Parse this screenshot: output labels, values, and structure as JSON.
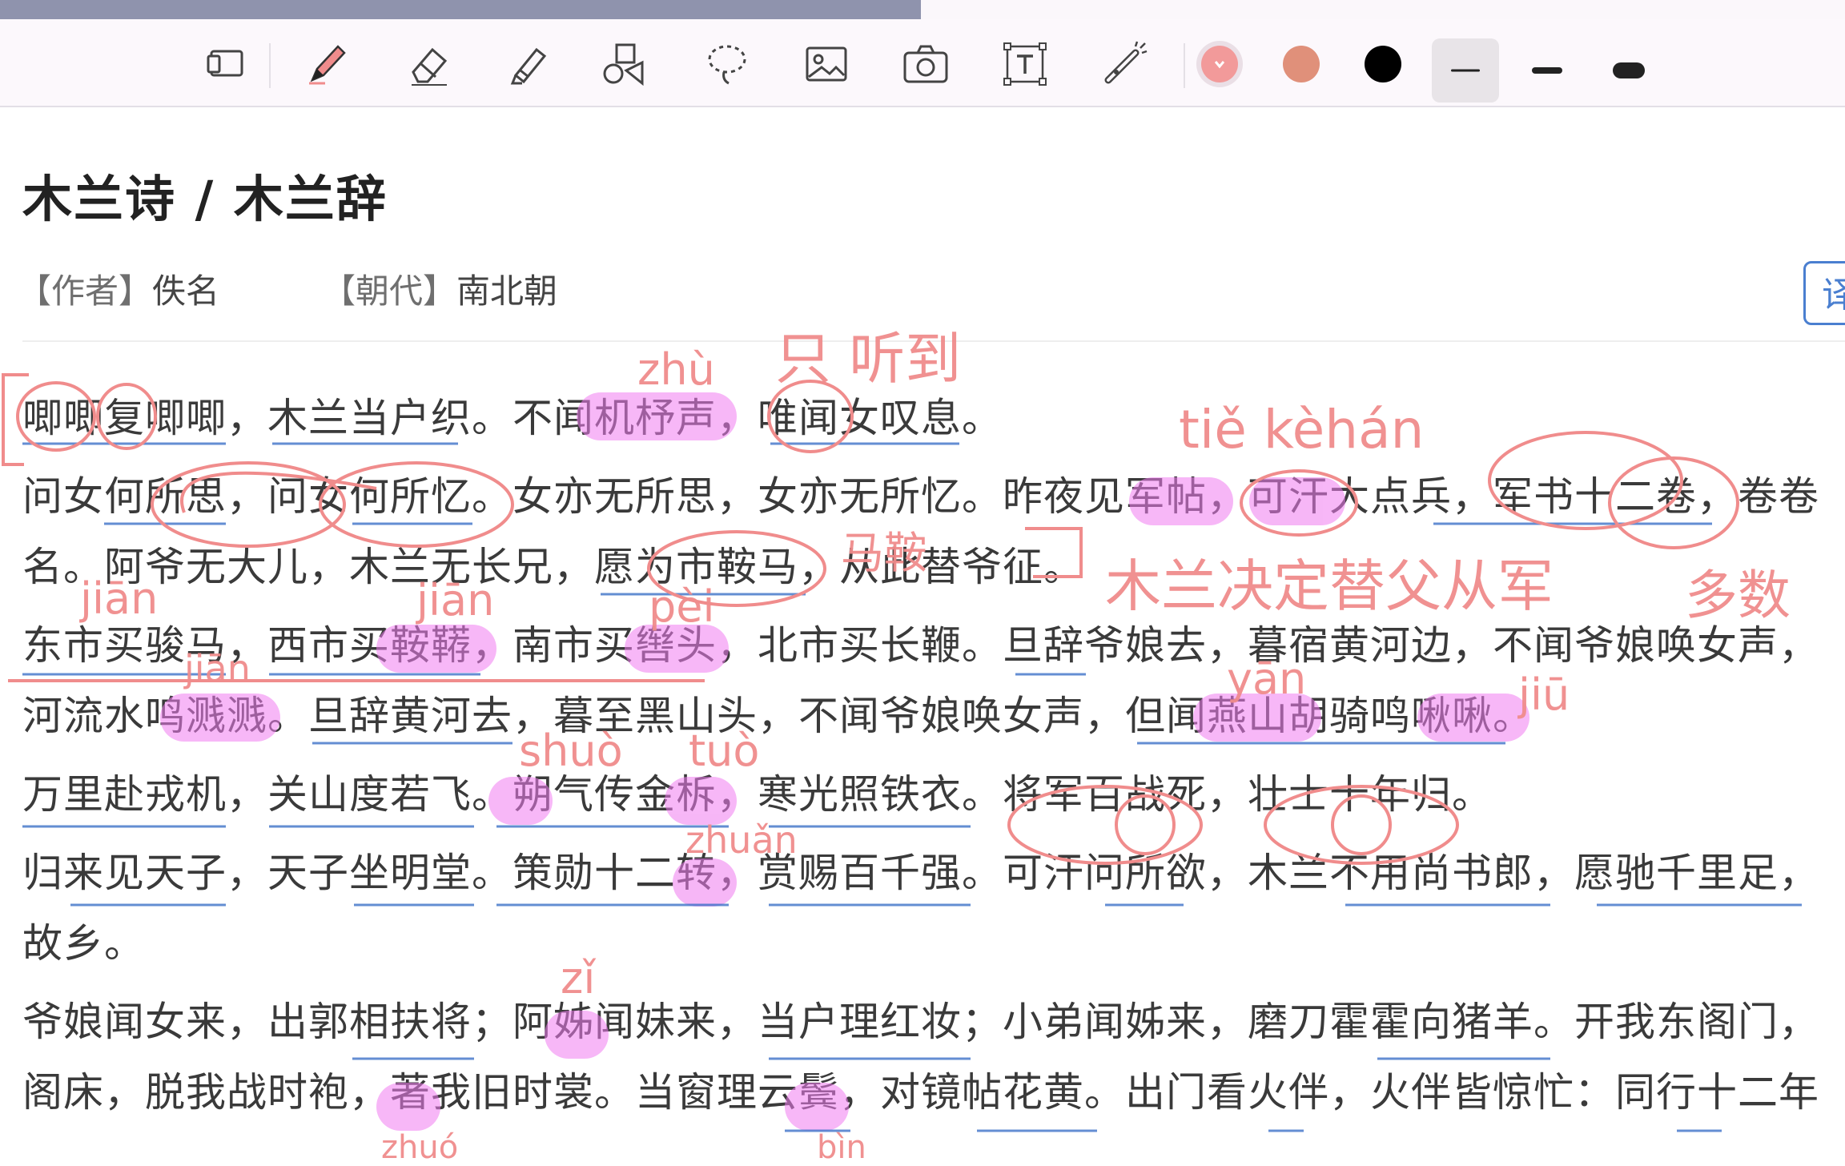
{
  "toolbar": {
    "tools": [
      {
        "name": "page-icon",
        "label": "Pages"
      },
      {
        "name": "pen-icon",
        "label": "Pen"
      },
      {
        "name": "eraser-icon",
        "label": "Eraser"
      },
      {
        "name": "highlighter-icon",
        "label": "Highlighter"
      },
      {
        "name": "shapes-icon",
        "label": "Shapes"
      },
      {
        "name": "lasso-icon",
        "label": "Lasso"
      },
      {
        "name": "image-icon",
        "label": "Image"
      },
      {
        "name": "camera-icon",
        "label": "Camera"
      },
      {
        "name": "text-box-icon",
        "label": "Text"
      },
      {
        "name": "laser-pointer-icon",
        "label": "Laser"
      }
    ],
    "colors": [
      "#f29a9a",
      "#e0907a",
      "#000000"
    ],
    "selected_color": "#f29a9a"
  },
  "article": {
    "title": "木兰诗 / 木兰辞",
    "author_label": "【作者】",
    "author": "佚名",
    "dynasty_label": "【朝代】",
    "dynasty": "南北朝",
    "translate_button": "译"
  },
  "poem": {
    "lines": [
      "唧唧复唧唧，木兰当户织。不闻机杼声，唯闻女叹息。",
      "问女何所思，问女何所忆。女亦无所思，女亦无所忆。昨夜见军帖，可汗大点兵，军书十二卷，卷卷",
      "名。阿爷无大儿，木兰无长兄，愿为市鞍马，从此替爷征。",
      "东市买骏马，西市买鞍鞯，南市买辔头，北市买长鞭。旦辞爷娘去，暮宿黄河边，不闻爷娘唤女声，",
      "河流水鸣溅溅。旦辞黄河去，暮至黑山头，不闻爷娘唤女声，但闻燕山胡骑鸣啾啾。",
      "万里赴戎机，关山度若飞。朔气传金柝，寒光照铁衣。将军百战死，壮士十年归。",
      "归来见天子，天子坐明堂。策勋十二转，赏赐百千强。可汗问所欲，木兰不用尚书郎，愿驰千里足，",
      "故乡。",
      "爷娘闻女来，出郭相扶将；阿姊闻妹来，当户理红妆；小弟闻姊来，磨刀霍霍向猪羊。开我东阁门，",
      "阁床，脱我战时袍，著我旧时裳。当窗理云鬓，对镜帖花黄。出门看火伴，火伴皆惊忙：同行十二年"
    ]
  },
  "annotations": {
    "ink_color": "#f08c8c",
    "highlight_color": "#f07cf0",
    "notes": [
      "zhù",
      "只 听到",
      "tiě kèhán",
      "马鞍",
      "木兰决定替父从军",
      "多数",
      "jiān",
      "jiān",
      "pèi",
      "jiān",
      "yān",
      "jiū",
      "shuò",
      "tuò",
      "zhuǎn",
      "zǐ",
      "zhuó",
      "bìn"
    ]
  }
}
